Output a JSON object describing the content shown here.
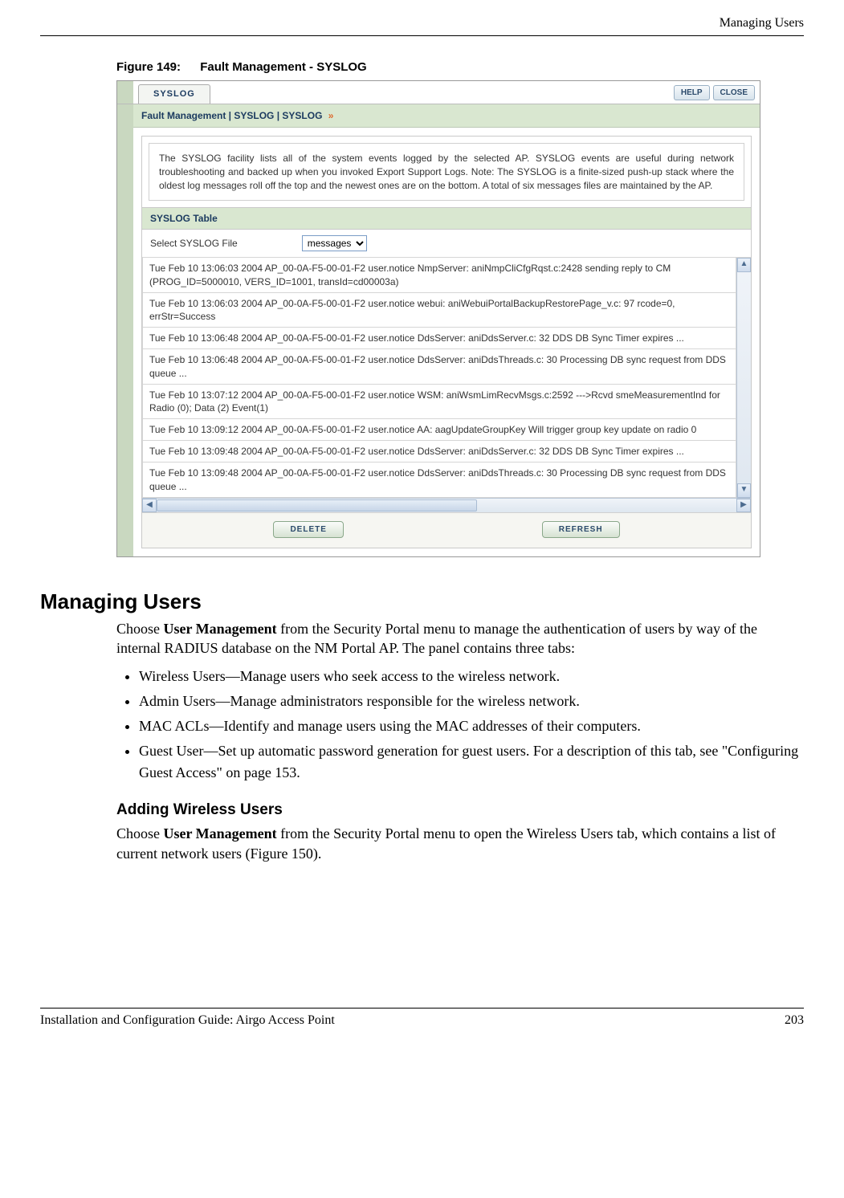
{
  "runningHeader": "Managing Users",
  "figure": {
    "label": "Figure 149:",
    "title": "Fault Management - SYSLOG"
  },
  "screenshot": {
    "tab": "SYSLOG",
    "helpBtn": "HELP",
    "closeBtn": "CLOSE",
    "breadcrumb": "Fault Management | SYSLOG | SYSLOG",
    "breadcrumbArrows": "»",
    "description": "The SYSLOG facility lists all of the system events logged by the selected AP. SYSLOG events are useful during network troubleshooting and backed up when you invoked Export Support Logs. Note: The SYSLOG is a finite-sized push-up stack where the oldest log messages roll off the top and the newest ones are on the bottom. A total of six messages files are maintained by the AP.",
    "tableHeader": "SYSLOG Table",
    "selectLabel": "Select SYSLOG File",
    "selectValue": "messages",
    "log": [
      "Tue Feb 10 13:06:03 2004 AP_00-0A-F5-00-01-F2 user.notice NmpServer: aniNmpCliCfgRqst.c:2428 sending reply to CM (PROG_ID=5000010, VERS_ID=1001, transId=cd00003a)",
      "Tue Feb 10 13:06:03 2004 AP_00-0A-F5-00-01-F2 user.notice webui: aniWebuiPortalBackupRestorePage_v.c: 97 rcode=0, errStr=Success",
      "Tue Feb 10 13:06:48 2004 AP_00-0A-F5-00-01-F2 user.notice DdsServer: aniDdsServer.c: 32 DDS DB Sync Timer expires ...",
      "Tue Feb 10 13:06:48 2004 AP_00-0A-F5-00-01-F2 user.notice DdsServer: aniDdsThreads.c: 30 Processing DB sync request from DDS queue ...",
      "Tue Feb 10 13:07:12 2004 AP_00-0A-F5-00-01-F2 user.notice WSM: aniWsmLimRecvMsgs.c:2592 --->Rcvd smeMeasurementInd for Radio (0); Data (2) Event(1)",
      "Tue Feb 10 13:09:12 2004 AP_00-0A-F5-00-01-F2 user.notice AA: aagUpdateGroupKey Will trigger group key update on radio 0",
      "Tue Feb 10 13:09:48 2004 AP_00-0A-F5-00-01-F2 user.notice DdsServer: aniDdsServer.c: 32 DDS DB Sync Timer expires ...",
      "Tue Feb 10 13:09:48 2004 AP_00-0A-F5-00-01-F2 user.notice DdsServer: aniDdsThreads.c: 30 Processing DB sync request from DDS queue ..."
    ],
    "deleteBtn": "DELETE",
    "refreshBtn": "REFRESH"
  },
  "section": {
    "heading": "Managing Users",
    "intro1a": "Choose ",
    "intro1bold": "User Management",
    "intro1b": " from the Security Portal menu to manage the authentication of users by way of the internal RADIUS database on the NM Portal AP. The panel contains three tabs:",
    "bullets": [
      "Wireless Users—Manage users who seek access to the wireless network.",
      "Admin Users—Manage administrators responsible for the wireless network.",
      "MAC ACLs—Identify and manage users using the MAC addresses of their computers.",
      "Guest User—Set up automatic password generation for guest users. For a description of this tab, see \"Configuring Guest Access\" on page 153."
    ],
    "subheading": "Adding Wireless Users",
    "sub1a": "Choose ",
    "sub1bold": "User Management",
    "sub1b": " from the Security Portal menu to open the Wireless Users tab, which contains a list of current network users (Figure 150)."
  },
  "footer": {
    "left": "Installation and Configuration Guide: Airgo Access Point",
    "right": "203"
  }
}
